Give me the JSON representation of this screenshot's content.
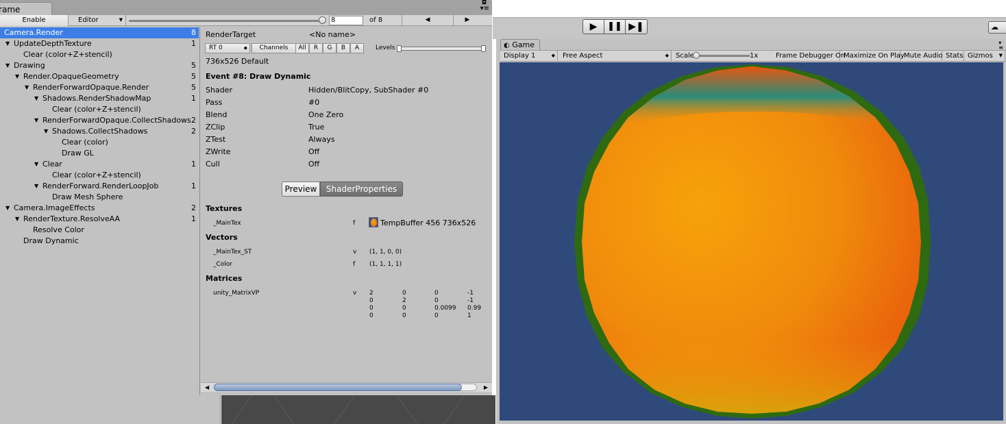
{
  "frame_debugger": {
    "tab_title": "Frame Debug",
    "toolbar": {
      "enable_label": "Enable",
      "target_label": "Editor",
      "event_index": "8",
      "event_count_label": "of 8",
      "prev_label": "◀",
      "next_label": "▶"
    },
    "tree": [
      {
        "label": "Camera.Render",
        "count": "8",
        "selected": true
      },
      {
        "label": "UpdateDepthTexture",
        "count": "1"
      },
      {
        "label": "Clear (color+Z+stencil)",
        "count": ""
      },
      {
        "label": "Drawing",
        "count": "5"
      },
      {
        "label": "Render.OpaqueGeometry",
        "count": "5"
      },
      {
        "label": "RenderForwardOpaque.Render",
        "count": "5"
      },
      {
        "label": "Shadows.RenderShadowMap",
        "count": "1"
      },
      {
        "label": "Clear (color+Z+stencil)",
        "count": ""
      },
      {
        "label": "RenderForwardOpaque.CollectShadows",
        "count": "2"
      },
      {
        "label": "Shadows.CollectShadows",
        "count": "2"
      },
      {
        "label": "Clear (color)",
        "count": ""
      },
      {
        "label": "Draw GL",
        "count": ""
      },
      {
        "label": "Clear",
        "count": "1"
      },
      {
        "label": "Clear (color+Z+stencil)",
        "count": ""
      },
      {
        "label": "RenderForward.RenderLoopJob",
        "count": "1"
      },
      {
        "label": "Draw Mesh Sphere",
        "count": ""
      },
      {
        "label": "Camera.ImageEffects",
        "count": "2"
      },
      {
        "label": "RenderTexture.ResolveAA",
        "count": "1"
      },
      {
        "label": "Resolve Color",
        "count": ""
      },
      {
        "label": "Draw Dynamic",
        "count": ""
      }
    ],
    "detail": {
      "render_target_label": "RenderTarget",
      "render_target_value": "<No name>",
      "rt_dropdown": "RT 0",
      "channels_label": "Channels",
      "channels": [
        "All",
        "R",
        "G",
        "B",
        "A"
      ],
      "levels_label": "Levels",
      "resolution": "736x526 Default",
      "event_title": "Event #8: Draw Dynamic",
      "props": [
        {
          "key": "Shader",
          "value": "Hidden/BlitCopy, SubShader #0"
        },
        {
          "key": "Pass",
          "value": "#0"
        },
        {
          "key": "Blend",
          "value": "One Zero"
        },
        {
          "key": "ZClip",
          "value": "True"
        },
        {
          "key": "ZTest",
          "value": "Always"
        },
        {
          "key": "ZWrite",
          "value": "Off"
        },
        {
          "key": "Cull",
          "value": "Off"
        }
      ],
      "tabs": {
        "preview": "Preview",
        "shader_properties": "ShaderProperties"
      },
      "textures_header": "Textures",
      "textures": [
        {
          "name": "_MainTex",
          "stage": "f",
          "value": "TempBuffer 456 736x526"
        }
      ],
      "vectors_header": "Vectors",
      "vectors": [
        {
          "name": "_MainTex_ST",
          "stage": "v",
          "value": "(1, 1, 0, 0)"
        },
        {
          "name": "_Color",
          "stage": "f",
          "value": "(1, 1, 1, 1)"
        }
      ],
      "matrices_header": "Matrices",
      "matrix": {
        "name": "unity_MatrixVP",
        "stage": "v",
        "rows": [
          [
            "2",
            "0",
            "0",
            "-1"
          ],
          [
            "0",
            "2",
            "0",
            "-1"
          ],
          [
            "0",
            "0",
            "0.0099",
            "0.99"
          ],
          [
            "0",
            "0",
            "0",
            "1"
          ]
        ]
      }
    }
  },
  "game_view": {
    "tab_title": "Game",
    "display": "Display 1",
    "aspect": "Free Aspect",
    "scale_label": "Scale",
    "scale_value": "1x",
    "toggles": [
      "Frame Debugger On",
      "Maximize On Play",
      "Mute Audio",
      "Stats",
      "Gizmos"
    ],
    "colors": {
      "background": "#2f4a7a",
      "sphere_main": "#f08a0c",
      "sphere_rim": "#2e6a10"
    }
  },
  "play_controls": {
    "play": "▶",
    "pause": "❚❚",
    "step": "▶❚"
  }
}
